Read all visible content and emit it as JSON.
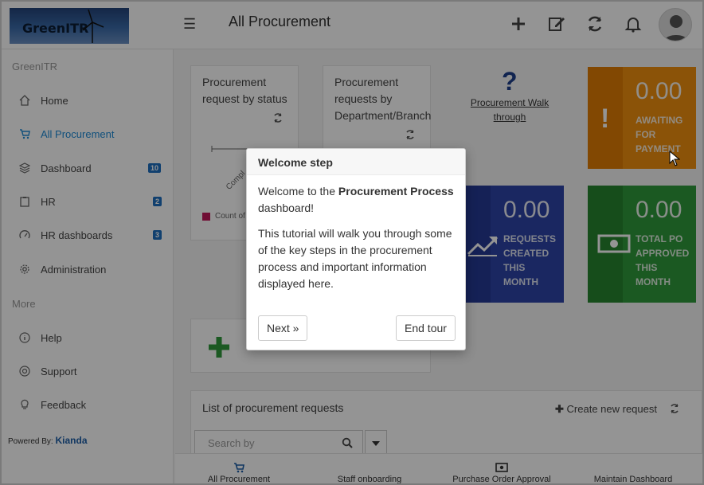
{
  "app": {
    "logo_text": "GreenITR",
    "page_title": "All Procurement"
  },
  "colors": {
    "accent": "#1e8bd6",
    "orange": "#f0900e",
    "blue": "#2d44a8",
    "green": "#2f9a3b",
    "badge": "#1e6fc0"
  },
  "toolbar": {
    "icons": [
      "plus-icon",
      "edit-icon",
      "refresh-icon",
      "bell-icon"
    ]
  },
  "sidebar": {
    "section_main": "GreenITR",
    "section_more": "More",
    "items": [
      {
        "label": "Home",
        "icon": "home-icon"
      },
      {
        "label": "All Procurement",
        "icon": "cart-icon",
        "active": true
      },
      {
        "label": "Dashboard",
        "icon": "layers-icon",
        "badge": "10"
      },
      {
        "label": "HR",
        "icon": "clipboard-icon",
        "badge": "2"
      },
      {
        "label": "HR dashboards",
        "icon": "gauge-icon",
        "badge": "3"
      },
      {
        "label": "Administration",
        "icon": "gear-icon"
      }
    ],
    "more_items": [
      {
        "label": "Help",
        "icon": "info-icon"
      },
      {
        "label": "Support",
        "icon": "lifebuoy-icon"
      },
      {
        "label": "Feedback",
        "icon": "bulb-icon"
      }
    ],
    "powered_by": "Powered By:",
    "powered_brand": "Kianda"
  },
  "cards": {
    "status_title": "Procurement request by status",
    "dept_title": "Procurement requests by Department/Branch",
    "walkthrough_link": "Procurement Walk through",
    "walkthrough_icon": "question-icon",
    "legend_partial": "Count of",
    "axis_partial": "Compl"
  },
  "tiles": {
    "awaiting": {
      "value": "0.00",
      "label": "Awaiting for payment"
    },
    "created": {
      "value": "0.00",
      "label": "Requests created this month"
    },
    "approved": {
      "value": "0.00",
      "label": "Total PO approved this month"
    }
  },
  "list": {
    "title": "List of procurement requests",
    "create_label": "Create new request",
    "search_placeholder": "Search by"
  },
  "bottom_nav": [
    "All Procurement",
    "Staff onboarding",
    "Purchase Order Approval",
    "Maintain Dashboard"
  ],
  "tour": {
    "title": "Welcome step",
    "line1_pre": "Welcome to the ",
    "line1_bold": "Procurement Process",
    "line1_post": " dashboard!",
    "line2": "This tutorial will walk you through some of the key steps in the procurement process and important information displayed here.",
    "next_label": "Next »",
    "end_label": "End tour"
  }
}
